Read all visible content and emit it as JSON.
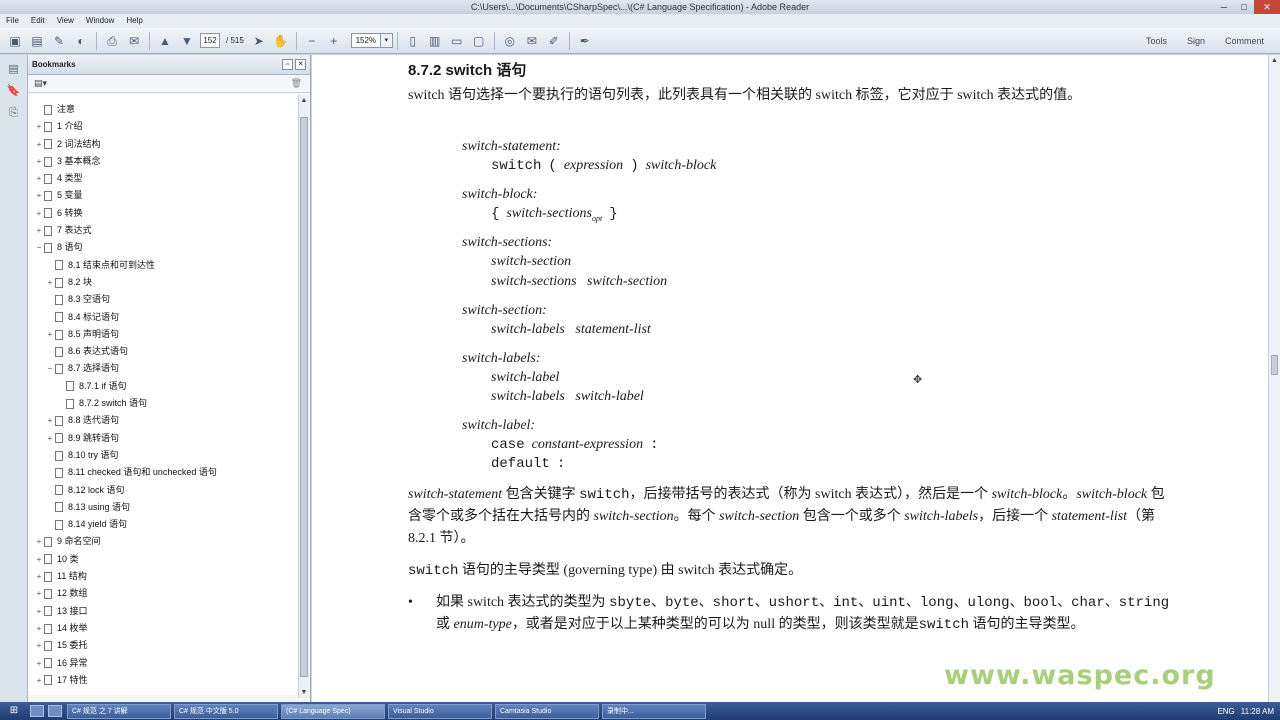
{
  "window": {
    "title": "C:\\Users\\...\\Documents\\CSharpSpec\\...\\(C# Language Specification) - Adobe Reader",
    "min": "─",
    "max": "□",
    "close": "✕"
  },
  "menu": [
    "File",
    "Edit",
    "View",
    "Window",
    "Help"
  ],
  "toolbar": {
    "page_current": "152",
    "page_total": "/ 515",
    "zoom": "152%",
    "zoom_arrow": "▾",
    "right": [
      "Tools",
      "Sign",
      "Comment"
    ]
  },
  "bookmarks": {
    "title": "Bookmarks",
    "options_label": "▤▾",
    "delete_icon": "🗑",
    "items": [
      {
        "label": "注意",
        "level": 0,
        "toggle": ""
      },
      {
        "label": "1 介绍",
        "level": 0,
        "toggle": "+"
      },
      {
        "label": "2 词法结构",
        "level": 0,
        "toggle": "+"
      },
      {
        "label": "3 基本概念",
        "level": 0,
        "toggle": "+"
      },
      {
        "label": "4 类型",
        "level": 0,
        "toggle": "+"
      },
      {
        "label": "5 变量",
        "level": 0,
        "toggle": "+"
      },
      {
        "label": "6 转换",
        "level": 0,
        "toggle": "+"
      },
      {
        "label": "7 表达式",
        "level": 0,
        "toggle": "+"
      },
      {
        "label": "8 语句",
        "level": 0,
        "toggle": "−"
      },
      {
        "label": "8.1 结束点和可到达性",
        "level": 1,
        "toggle": ""
      },
      {
        "label": "8.2 块",
        "level": 1,
        "toggle": "+"
      },
      {
        "label": "8.3 空语句",
        "level": 1,
        "toggle": ""
      },
      {
        "label": "8.4 标记语句",
        "level": 1,
        "toggle": ""
      },
      {
        "label": "8.5 声明语句",
        "level": 1,
        "toggle": "+"
      },
      {
        "label": "8.6 表达式语句",
        "level": 1,
        "toggle": ""
      },
      {
        "label": "8.7 选择语句",
        "level": 1,
        "toggle": "−"
      },
      {
        "label": "8.7.1 if 语句",
        "level": 2,
        "toggle": ""
      },
      {
        "label": "8.7.2 switch 语句",
        "level": 2,
        "toggle": ""
      },
      {
        "label": "8.8 迭代语句",
        "level": 1,
        "toggle": "+"
      },
      {
        "label": "8.9 跳转语句",
        "level": 1,
        "toggle": "+"
      },
      {
        "label": "8.10 try 语句",
        "level": 1,
        "toggle": ""
      },
      {
        "label": "8.11 checked 语句和 unchecked 语句",
        "level": 1,
        "toggle": ""
      },
      {
        "label": "8.12 lock 语句",
        "level": 1,
        "toggle": ""
      },
      {
        "label": "8.13 using 语句",
        "level": 1,
        "toggle": ""
      },
      {
        "label": "8.14 yield 语句",
        "level": 1,
        "toggle": ""
      },
      {
        "label": "9 命名空间",
        "level": 0,
        "toggle": "+"
      },
      {
        "label": "10 类",
        "level": 0,
        "toggle": "+"
      },
      {
        "label": "11 结构",
        "level": 0,
        "toggle": "+"
      },
      {
        "label": "12 数组",
        "level": 0,
        "toggle": "+"
      },
      {
        "label": "13 接口",
        "level": 0,
        "toggle": "+"
      },
      {
        "label": "14 枚举",
        "level": 0,
        "toggle": "+"
      },
      {
        "label": "15 委托",
        "level": 0,
        "toggle": "+"
      },
      {
        "label": "16 异常",
        "level": 0,
        "toggle": "+"
      },
      {
        "label": "17 特性",
        "level": 0,
        "toggle": "+"
      }
    ]
  },
  "doc": {
    "heading": "8.7.2 switch 语句",
    "intro": "switch 语句选择一个要执行的语句列表，此列表具有一个相关联的 switch 标签，它对应于 switch 表达式的值。",
    "grammar": {
      "switch_statement": "switch-statement:",
      "switch_kw": "switch",
      "lparen": "(",
      "expression": "expression",
      "rparen": ")",
      "switch_block_ref": "switch-block",
      "switch_block": "switch-block:",
      "lbrace": "{",
      "switch_sections_opt": "switch-sections",
      "opt": "opt",
      "rbrace": "}",
      "switch_sections": "switch-sections:",
      "ss_1": "switch-section",
      "ss_2a": "switch-sections",
      "ss_2b": "switch-section",
      "switch_section": "switch-section:",
      "sec_a": "switch-labels",
      "sec_b": "statement-list",
      "switch_labels": "switch-labels:",
      "sl_1": "switch-label",
      "sl_2a": "switch-labels",
      "sl_2b": "switch-label",
      "switch_label": "switch-label:",
      "case_kw": "case",
      "constant_expression": "constant-expression",
      "colon1": ":",
      "default_kw": "default",
      "colon2": ":"
    },
    "para2_a": "switch-statement",
    "para2_b": " 包含关键字 ",
    "para2_c": "switch",
    "para2_d": "，后接带括号的表达式（称为 switch 表达式），然后是一个 ",
    "para2_e": "switch-block",
    "para2_f": "。",
    "para2_g": "switch-block",
    "para2_h": " 包含零个或多个括在大括号内的 ",
    "para2_i": "switch-section",
    "para2_j": "。每个 ",
    "para2_k": "switch-section",
    "para2_l": " 包含一个或多个 ",
    "para2_m": "switch-labels",
    "para2_n": "，后接一个 ",
    "para2_o": "statement-list",
    "para2_p": "（第 8.2.1 节）。",
    "para3_a": "switch",
    "para3_b": " 语句的主导类型 (governing type) 由 switch 表达式确定。",
    "bullet": "•",
    "b1_a": "如果 switch 表达式的类型为 ",
    "b1_types": "sbyte、byte、short、ushort、int、uint、long、ulong、bool、",
    "b1_types2": "char、string",
    "b1_b": " 或 ",
    "b1_c": "enum-type",
    "b1_d": "，或者是对应于以上某种类型的可以为 null 的类型，则该类型就是",
    "b1_e": "switch",
    "b1_f": " 语句的主导类型。"
  },
  "watermark": "www.waspec.org",
  "taskbar": {
    "start": "⊞",
    "tasks": [
      "C# 规范 之 7 讲解",
      "C# 规范 中文版 5.0",
      "(C# Language Spec)",
      "Visual Studio",
      "Camtasia Studio",
      "录制中..."
    ],
    "tray": [
      "ENG",
      "11:28 AM"
    ]
  }
}
